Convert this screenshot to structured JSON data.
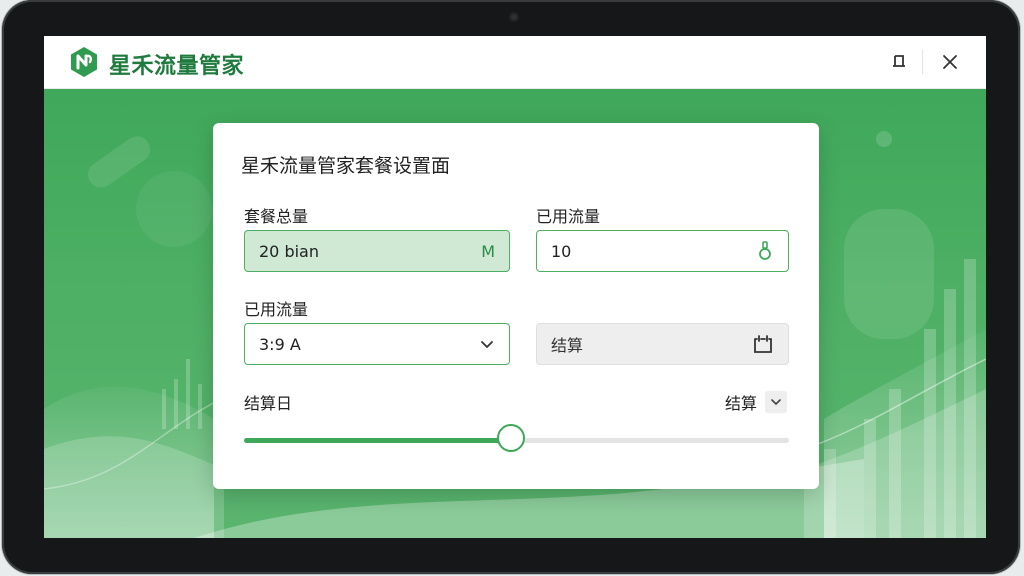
{
  "app": {
    "title": "星禾流量管家",
    "logo_icon": "n-leaf-logo-icon",
    "brand_color": "#3ea85a"
  },
  "window_controls": {
    "restore_icon": "restore-icon",
    "close_icon": "close-icon"
  },
  "dialog": {
    "title": "星禾流量管家套餐设置面",
    "total_plan": {
      "label": "套餐总量",
      "value": "20 bian",
      "unit": "M"
    },
    "used_traffic": {
      "label": "已用流量",
      "value": "10",
      "icon": "lock-icon"
    },
    "used_traffic_select": {
      "label": "已用流量",
      "value": "3:9 A",
      "icon": "chevron-down-icon"
    },
    "settle_field": {
      "value": "结算",
      "icon": "calendar-icon"
    },
    "billing_day": {
      "label": "结算日",
      "select_value": "结算",
      "slider_fraction": 0.49
    }
  }
}
